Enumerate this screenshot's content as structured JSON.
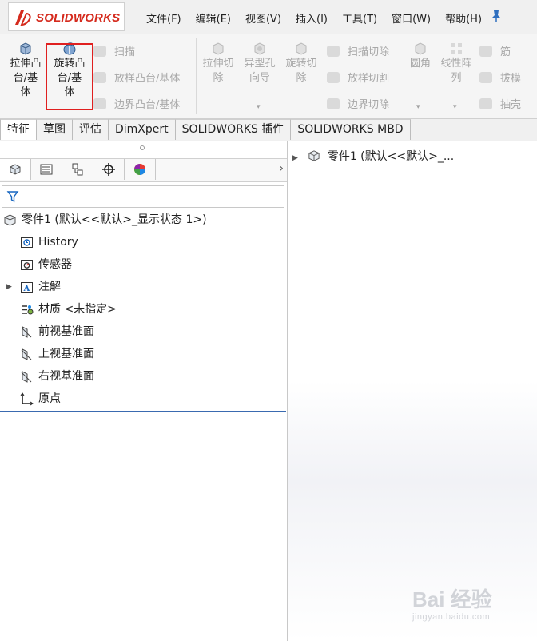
{
  "app": {
    "logo_text": "SOLIDWORKS"
  },
  "menu": [
    "文件(F)",
    "编辑(E)",
    "视图(V)",
    "插入(I)",
    "工具(T)",
    "窗口(W)",
    "帮助(H)"
  ],
  "ribbon": {
    "extrude_boss": "拉伸凸\n台/基\n体",
    "revolve_boss": "旋转凸\n台/基\n体",
    "sweep": "扫描",
    "loft_boss": "放样凸台/基体",
    "boundary_boss": "边界凸台/基体",
    "extrude_cut": "拉伸切\n除",
    "hole_wizard": "异型孔\n向导",
    "revolve_cut": "旋转切\n除",
    "swept_cut": "扫描切除",
    "lofted_cut": "放样切割",
    "boundary_cut": "边界切除",
    "fillet": "圆角",
    "linear_pattern": "线性阵\n列",
    "rib": "筋",
    "draft": "拔模",
    "shell": "抽壳"
  },
  "tabs": [
    "特征",
    "草图",
    "评估",
    "DimXpert",
    "SOLIDWORKS 插件",
    "SOLIDWORKS MBD"
  ],
  "tree": {
    "root": "零件1  (默认<<默认>_显示状态 1>)",
    "items": [
      "History",
      "传感器",
      "注解",
      "材质 <未指定>",
      "前视基准面",
      "上视基准面",
      "右视基准面",
      "原点"
    ]
  },
  "graphics": {
    "flyout_label": "零件1  (默认<<默认>_..."
  },
  "watermark": {
    "brand": "Bai 经验",
    "url": "jingyan.baidu.com"
  },
  "colors": {
    "highlight_box": "#e02020",
    "logo_red": "#d52b1e",
    "accent_blue": "#3a6ab0"
  }
}
